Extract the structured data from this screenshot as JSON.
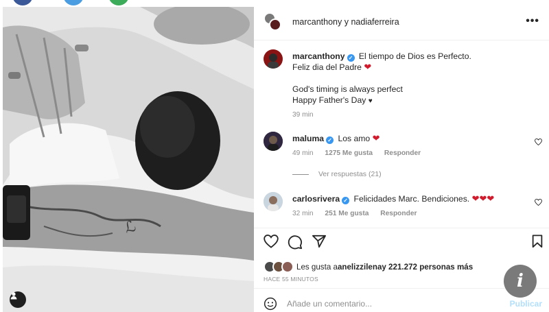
{
  "post": {
    "header": {
      "author1": "marcanthony",
      "joiner": " y ",
      "author2": "nadiaferreira",
      "more": "•••"
    },
    "caption": {
      "username": "marcanthony",
      "line1": "El tiempo de Dios es Perfecto.",
      "line2": "Feliz dia del Padre",
      "line3": "God's timing is always perfect",
      "line4": "Happy Father's Day",
      "small_heart": "♥",
      "time": "39 min"
    },
    "comments": [
      {
        "username": "maluma",
        "text": "Los amo",
        "time": "49 min",
        "likes": "1275 Me gusta",
        "reply": "Responder"
      },
      {
        "username": "carlosrivera",
        "text": "Felicidades Marc. Bendiciones.",
        "time": "32 min",
        "likes": "251 Me gusta",
        "reply": "Responder"
      }
    ],
    "view_replies": "Ver respuestas (21)",
    "likes_summary": {
      "prefix": "Les gusta a ",
      "user": "anelizzilena",
      "suffix": " y 221.272 personas más"
    },
    "time_ago": "HACE 55 MINUTOS",
    "add_comment": {
      "placeholder": "Añade un comentario...",
      "publish": "Publicar"
    },
    "info_icon": "i"
  },
  "icons": {
    "like": "heart-outline-icon",
    "comment": "comment-icon",
    "share": "share-icon",
    "save": "bookmark-icon",
    "emoji": "emoji-icon",
    "more": "more-icon"
  },
  "colors": {
    "heart_red": "#d11c2d",
    "verified_blue": "#3897f0",
    "muted": "#8e8e8e",
    "publish_disabled": "#b2dffc"
  }
}
